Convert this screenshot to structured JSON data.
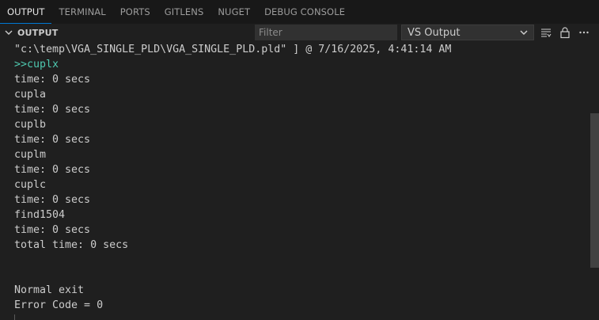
{
  "tabs": [
    {
      "label": "OUTPUT",
      "active": true
    },
    {
      "label": "TERMINAL",
      "active": false
    },
    {
      "label": "PORTS",
      "active": false
    },
    {
      "label": "GITLENS",
      "active": false
    },
    {
      "label": "NUGET",
      "active": false
    },
    {
      "label": "DEBUG CONSOLE",
      "active": false
    }
  ],
  "header": {
    "title": "OUTPUT",
    "filter_placeholder": "Filter",
    "channel": "VS Output"
  },
  "icons": {
    "collapse": "chevron-down-icon",
    "select": "chevron-down-icon",
    "word_wrap": "list-filter-icon",
    "lock": "lock-icon",
    "more": "ellipsis-icon"
  },
  "colors": {
    "accent": "#0078d4",
    "text": "#cccccc",
    "prompt": "#4ec9b0",
    "background": "#1f1f1f",
    "tabbar": "#181818"
  },
  "output_lines": [
    {
      "text": "\"c:\\temp\\VGA_SINGLE_PLD\\VGA_SINGLE_PLD.pld\" ] @ 7/16/2025, 4:41:14 AM",
      "kind": "normal"
    },
    {
      "text": ">>cuplx",
      "kind": "prompt"
    },
    {
      "text": "time: 0 secs",
      "kind": "normal"
    },
    {
      "text": "cupla",
      "kind": "normal"
    },
    {
      "text": "time: 0 secs",
      "kind": "normal"
    },
    {
      "text": "cuplb",
      "kind": "normal"
    },
    {
      "text": "time: 0 secs",
      "kind": "normal"
    },
    {
      "text": "cuplm",
      "kind": "normal"
    },
    {
      "text": "time: 0 secs",
      "kind": "normal"
    },
    {
      "text": "cuplc",
      "kind": "normal"
    },
    {
      "text": "time: 0 secs",
      "kind": "normal"
    },
    {
      "text": "find1504",
      "kind": "normal"
    },
    {
      "text": "time: 0 secs",
      "kind": "normal"
    },
    {
      "text": "total time: 0 secs",
      "kind": "normal"
    },
    {
      "text": "",
      "kind": "normal"
    },
    {
      "text": "",
      "kind": "normal"
    },
    {
      "text": "Normal exit",
      "kind": "normal"
    },
    {
      "text": "Error Code = 0",
      "kind": "normal"
    }
  ]
}
